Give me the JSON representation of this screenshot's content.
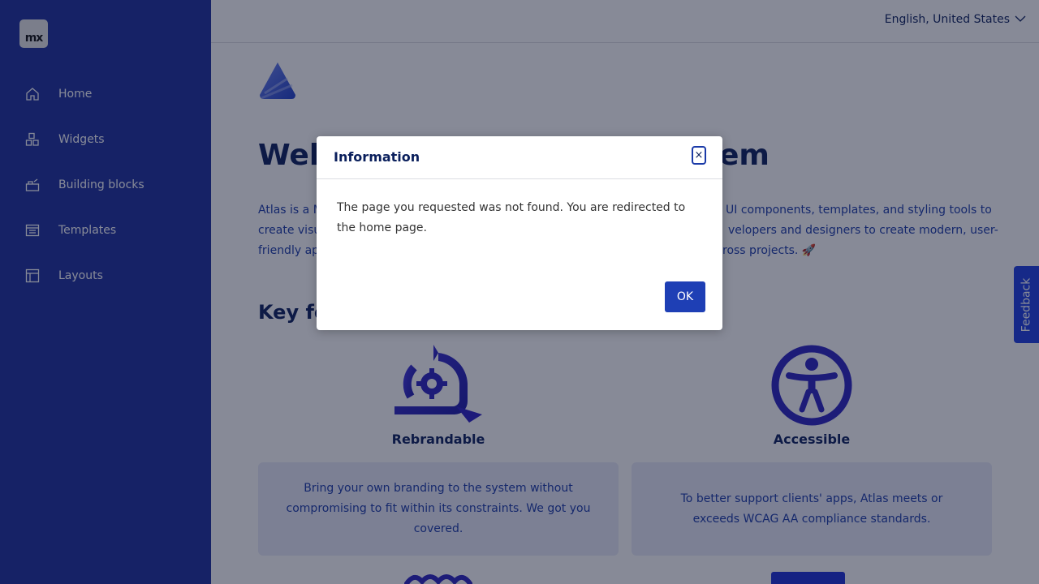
{
  "sidebar": {
    "logo_text": "mx",
    "items": [
      {
        "label": "Home",
        "icon": "home-icon"
      },
      {
        "label": "Widgets",
        "icon": "widgets-icon"
      },
      {
        "label": "Building blocks",
        "icon": "building-blocks-icon"
      },
      {
        "label": "Templates",
        "icon": "templates-icon"
      },
      {
        "label": "Layouts",
        "icon": "layouts-icon"
      }
    ]
  },
  "topbar": {
    "language": "English, United States"
  },
  "main": {
    "heading_start": "Wel",
    "heading_end": "em",
    "intro_lines": [
      {
        "left": "Atlas is a M",
        "right": "UI components, templates, and styling tools to"
      },
      {
        "left": "create visu",
        "right": "velopers and designers to create modern, user-"
      },
      {
        "left": "friendly ap",
        "right": "ross projects. 🚀"
      }
    ],
    "key_features_partial": "Key fe",
    "features": [
      {
        "title": "Rebrandable",
        "description": "Bring your own branding to the system without compromising to fit within its constraints. We got you covered.",
        "icon": "rebrand-gear-icon"
      },
      {
        "title": "Accessible",
        "description": "To better support clients' apps, Atlas meets or exceeds WCAG AA compliance standards.",
        "icon": "accessibility-icon"
      }
    ]
  },
  "feedback_label": "Feedback",
  "modal": {
    "title": "Information",
    "close_symbol": "×",
    "message": "The page you requested was not found. You are redirected to the home page.",
    "ok_label": "OK"
  },
  "colors": {
    "sidebar_bg": "#1c2f9c",
    "accent": "#1e3fb5",
    "heading": "#0a1f5c",
    "card_bg": "#e9ebf8"
  }
}
